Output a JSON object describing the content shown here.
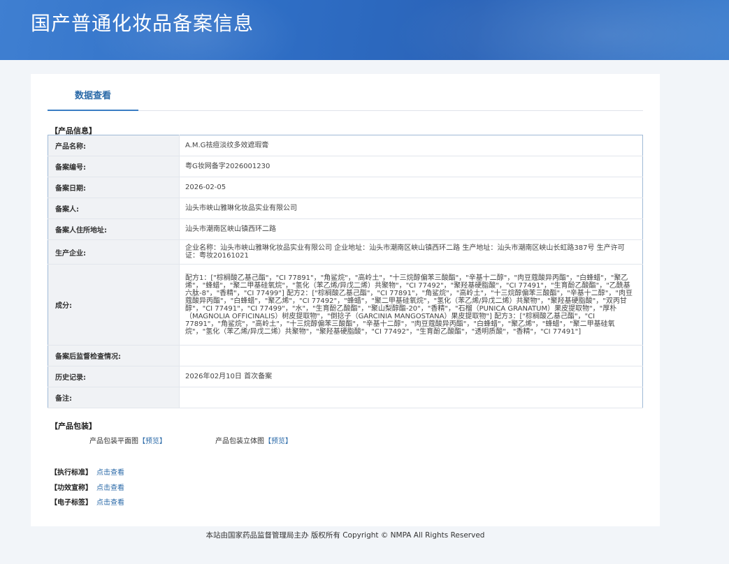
{
  "header": {
    "title": "国产普通化妆品备案信息"
  },
  "tabs": [
    {
      "label": "数据查看"
    }
  ],
  "product_info": {
    "section_title": "【产品信息】",
    "rows": [
      {
        "label": "产品名称:",
        "value": "A.M.G祛痘淡纹多效遮瑕膏"
      },
      {
        "label": "备案编号:",
        "value": "粤G妆网备字2026001230"
      },
      {
        "label": "备案日期:",
        "value": "2026-02-05"
      },
      {
        "label": "备案人:",
        "value": "汕头市峡山雅琳化妆品实业有限公司"
      },
      {
        "label": "备案人住所地址:",
        "value": "汕头市潮南区峡山镇西环二路"
      },
      {
        "label": "生产企业:",
        "value": "企业名称：汕头市峡山雅琳化妆品实业有限公司 企业地址：汕头市潮南区峡山镇西环二路 生产地址：汕头市潮南区峡山长虹路387号 生产许可证：粤妆20161021"
      },
      {
        "label": "成分:",
        "value": "配方1：[\"棕榈酸乙基己酯\"，\"CI 77891\"，\"角鲨烷\"，\"高岭土\"，\"十三烷醇偏苯三酸酯\"，\"辛基十二醇\"，\"肉豆蔻酸异丙酯\"，\"白蜂蜡\"，\"聚乙烯\"，\"蜂蜡\"，\"聚二甲基硅氧烷\"，\"氢化（苯乙烯/异戊二烯）共聚物\"，\"CI 77492\"，\"聚羟基硬脂酸\"，\"CI 77491\"，\"生育酚乙酸酯\"，\"乙酰基六肽-8\"，\"香精\"，\"CI 77499\"] 配方2：[\"棕榈酸乙基己酯\"，\"CI 77891\"，\"角鲨烷\"，\"高岭土\"，\"十三烷醇偏苯三酸酯\"，\"辛基十二醇\"，\"肉豆蔻酸异丙酯\"，\"白蜂蜡\"，\"聚乙烯\"，\"CI 77492\"，\"蜂蜡\"，\"聚二甲基硅氧烷\"，\"氢化（苯乙烯/异戊二烯）共聚物\"，\"聚羟基硬脂酸\"，\"双丙甘醇\"，\"CI 77491\"，\"CI 77499\"，\"水\"，\"生育酚乙酸酯\"，\"聚山梨醇酯-20\"，\"香精\"，\"石榴（PUNICA GRANATUM）果皮提取物\"，\"厚朴（MAGNOLIA OFFICINALIS）树皮提取物\"，\"倒捻子（GARCINIA MANGOSTANA）果皮提取物\"] 配方3：[\"棕榈酸乙基己酯\"，\"CI 77891\"，\"角鲨烷\"，\"高岭土\"，\"十三烷醇偏苯三酸酯\"，\"辛基十二醇\"，\"肉豆蔻酸异丙酯\"，\"白蜂蜡\"，\"聚乙烯\"，\"蜂蜡\"，\"聚二甲基硅氧烷\"，\"氢化（苯乙烯/异戊二烯）共聚物\"，\"聚羟基硬脂酸\"，\"CI 77492\"，\"生育酚乙酸酯\"，\"透明质酸\"，\"香精\"，\"CI 77491\"]"
      },
      {
        "label": "备案后监督检查情况:",
        "value": ""
      },
      {
        "label": "历史记录:",
        "value": "2026年02月10日 首次备案"
      },
      {
        "label": "备注:",
        "value": ""
      }
    ]
  },
  "packaging": {
    "section_title": "【产品包装】",
    "flat_label": "产品包装平面图",
    "solid_label": "产品包装立体图",
    "preview_open": "【",
    "preview_text": "预览",
    "preview_close": "】"
  },
  "links": [
    {
      "tag": "【执行标准】",
      "text": "点击查看"
    },
    {
      "tag": "【功效宣称】",
      "text": "点击查看"
    },
    {
      "tag": "【电子标签】",
      "text": "点击查看"
    }
  ],
  "footer": {
    "text": "本站由国家药品监督管理局主办 版权所有 Copyright © NMPA All Rights Reserved"
  },
  "colors": {
    "banner": "#2f6fc6",
    "link": "#2b6aa8",
    "label_bg": "#f0f2f5",
    "table_border": "#9fb9d6"
  }
}
